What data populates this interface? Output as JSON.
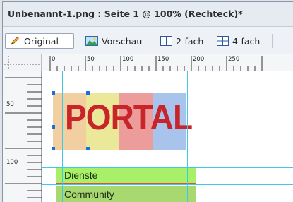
{
  "window": {
    "title": "Unbenannt-1.png : Seite 1 @ 100% (Rechteck)*"
  },
  "toolbar": {
    "original_label": "Original",
    "preview_label": "Vorschau",
    "twoup_label": "2-fach",
    "fourup_label": "4-fach"
  },
  "ruler": {
    "h_labels": [
      "0",
      "50",
      "100",
      "150",
      "200",
      "250"
    ],
    "v_labels": [
      "50",
      "100"
    ]
  },
  "canvas": {
    "logo_text": "PORTAL",
    "strip_colors": [
      "#f2cfa0",
      "#ece89a",
      "#ed9c9c",
      "#a8c4ec"
    ],
    "logo_color": "#c8252a",
    "menu_items": [
      {
        "label": "Dienste",
        "color": "#a8f068"
      },
      {
        "label": "Community",
        "color": "#a8d870"
      }
    ],
    "guide_color": "#40c8e8",
    "handle_color": "#1a6fe0"
  },
  "icons": {
    "original": "pencil-icon",
    "preview": "image-icon",
    "twoup": "two-panel-icon",
    "fourup": "four-panel-icon"
  }
}
